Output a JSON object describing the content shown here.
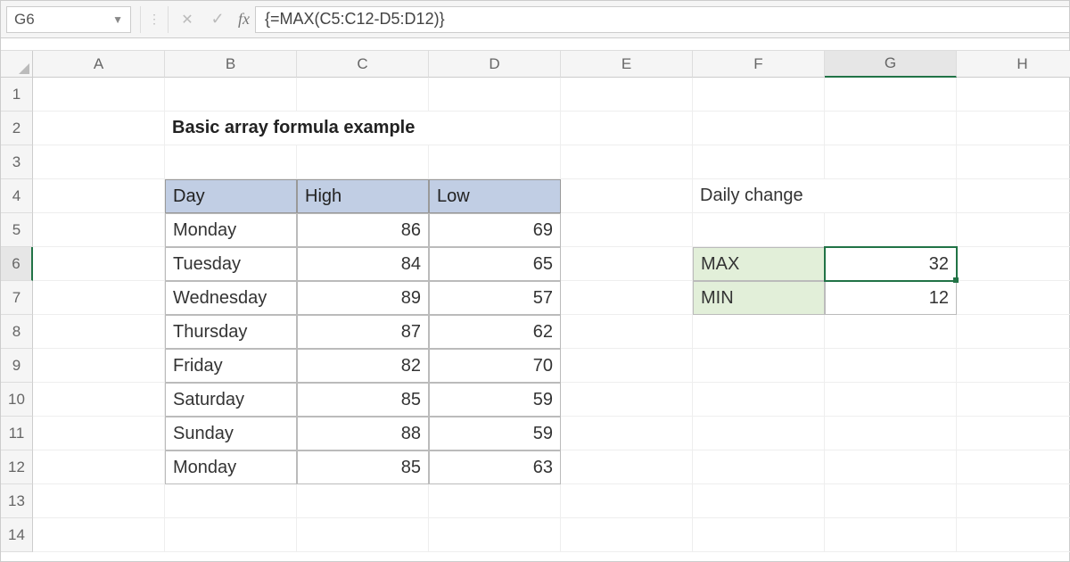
{
  "name_box": "G6",
  "formula": "{=MAX(C5:C12-D5:D12)}",
  "columns": [
    "A",
    "B",
    "C",
    "D",
    "E",
    "F",
    "G",
    "H"
  ],
  "rows": [
    "1",
    "2",
    "3",
    "4",
    "5",
    "6",
    "7",
    "8",
    "9",
    "10",
    "11",
    "12",
    "13",
    "14"
  ],
  "selected_col": "G",
  "selected_row": "6",
  "title": "Basic array formula example",
  "table": {
    "headers": [
      "Day",
      "High",
      "Low"
    ],
    "rows": [
      {
        "day": "Monday",
        "high": 86,
        "low": 69
      },
      {
        "day": "Tuesday",
        "high": 84,
        "low": 65
      },
      {
        "day": "Wednesday",
        "high": 89,
        "low": 57
      },
      {
        "day": "Thursday",
        "high": 87,
        "low": 62
      },
      {
        "day": "Friday",
        "high": 82,
        "low": 70
      },
      {
        "day": "Saturday",
        "high": 85,
        "low": 59
      },
      {
        "day": "Sunday",
        "high": 88,
        "low": 59
      },
      {
        "day": "Monday",
        "high": 85,
        "low": 63
      }
    ]
  },
  "summary": {
    "title": "Daily change",
    "items": [
      {
        "label": "MAX",
        "value": 32
      },
      {
        "label": "MIN",
        "value": 12
      }
    ]
  }
}
